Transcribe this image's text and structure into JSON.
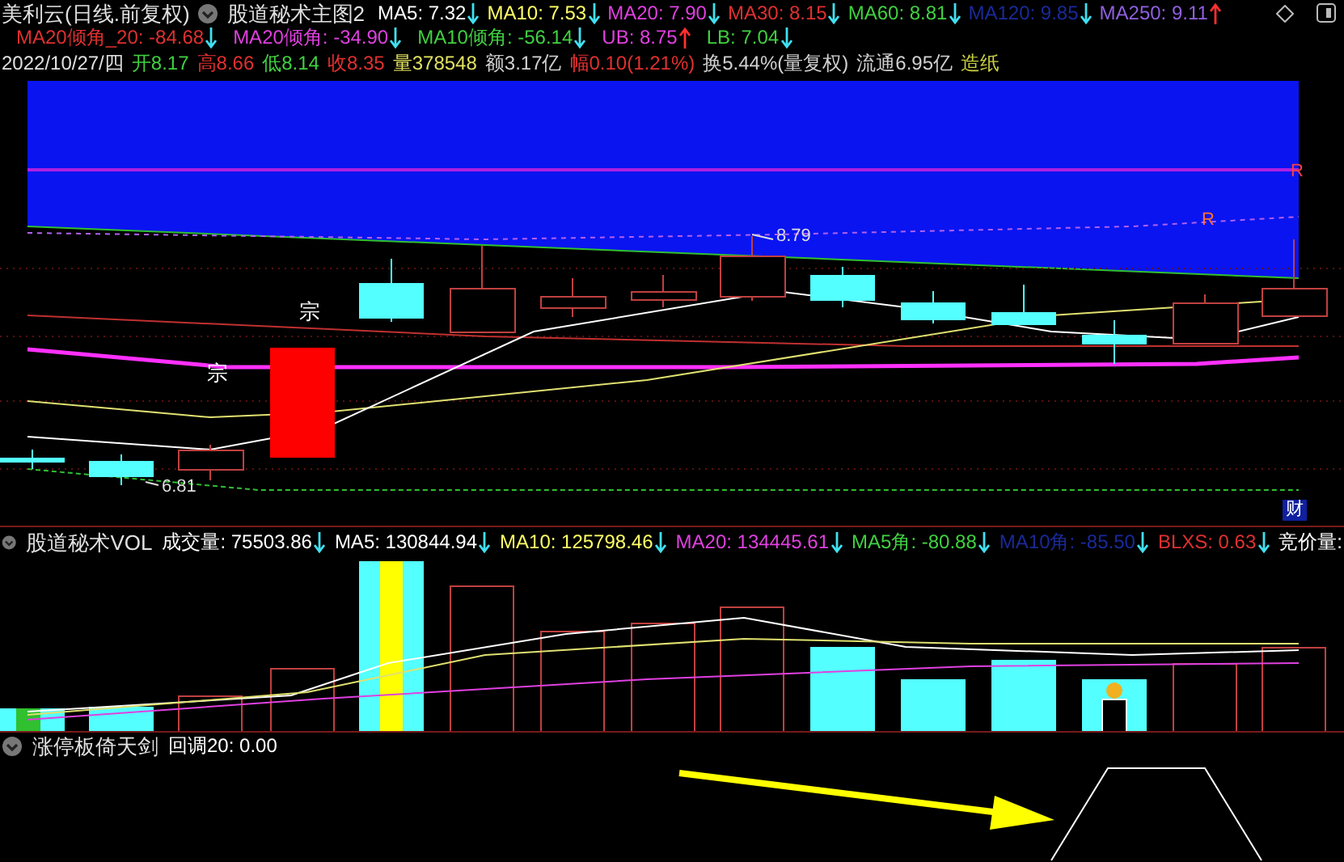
{
  "header": {
    "title": "美利云(日线.前复权)",
    "indicator": "股道秘术主图2",
    "values": [
      {
        "text": "MA5: 7.32",
        "color": "#ffffff",
        "rising": false
      },
      {
        "text": "MA10: 7.53",
        "color": "#ffff66",
        "rising": false
      },
      {
        "text": "MA20: 7.90",
        "color": "#e040e0",
        "rising": false
      },
      {
        "text": "MA30: 8.15",
        "color": "#e03030",
        "rising": false
      },
      {
        "text": "MA60: 8.81",
        "color": "#40d040",
        "rising": false
      },
      {
        "text": "MA120: 9.85",
        "color": "#1a2a9a",
        "rising": false
      },
      {
        "text": "MA250: 9.11",
        "color": "#9060e0",
        "rising": true
      }
    ],
    "values_2": [
      {
        "text": "MA20倾角_20: -84.68",
        "color": "#e03030",
        "rising": false
      },
      {
        "text": "MA20倾角: -34.90",
        "color": "#e040e0",
        "rising": false
      },
      {
        "text": "MA10倾角: -56.14",
        "color": "#40d040",
        "rising": false
      },
      {
        "text": "UB: 8.75",
        "color": "#e040e0",
        "rising": true
      },
      {
        "text": "LB: 7.04",
        "color": "#40d040",
        "rising": false
      }
    ]
  },
  "quote": {
    "date": "2022/10/27/四",
    "items": [
      {
        "text": "开8.17",
        "color": "#40d040"
      },
      {
        "text": "高8.66",
        "color": "#e03030"
      },
      {
        "text": "低8.14",
        "color": "#40d040"
      },
      {
        "text": "收8.35",
        "color": "#e03030"
      },
      {
        "text": "量378548",
        "color": "#e0e060"
      },
      {
        "text": "额3.17亿",
        "color": "#d0d0d0"
      },
      {
        "text": "幅0.10(1.21%)",
        "color": "#e03030"
      },
      {
        "text": "换5.44%(量复权)",
        "color": "#d0d0d0"
      },
      {
        "text": "流通6.95亿",
        "color": "#d0d0d0"
      },
      {
        "text": "造纸",
        "color": "#c8d040"
      }
    ]
  },
  "main_chart": {
    "labels": [
      {
        "text": "宗",
        "kind": "mark"
      },
      {
        "text": "宗",
        "kind": "mark"
      },
      {
        "text": "8.79",
        "kind": "high"
      },
      {
        "text": "6.81",
        "kind": "low"
      },
      {
        "text": "R",
        "kind": "r_right"
      },
      {
        "text": "R",
        "kind": "r_mid"
      },
      {
        "text": "财",
        "kind": "badge"
      }
    ]
  },
  "volume": {
    "indicator": "股道秘术VOL",
    "values": [
      {
        "text": "成交量: 75503.86",
        "color": "#ffffff",
        "rising": false
      },
      {
        "text": "MA5: 130844.94",
        "color": "#ffffff",
        "rising": false
      },
      {
        "text": "MA10: 125798.46",
        "color": "#ffff66",
        "rising": false
      },
      {
        "text": "MA20: 134445.61",
        "color": "#e040e0",
        "rising": false
      },
      {
        "text": "MA5角: -80.88",
        "color": "#40d040",
        "rising": false
      },
      {
        "text": "MA10角: -85.50",
        "color": "#1a2a9a",
        "rising": false
      },
      {
        "text": "BLXS: 0.63",
        "color": "#e03030",
        "rising": false
      },
      {
        "text": "竞价量:",
        "color": "#ffffff"
      }
    ]
  },
  "bottom": {
    "indicator": "涨停板倚天剑",
    "values": [
      {
        "text": "回调20: 0.00",
        "color": "#ffffff"
      }
    ]
  }
}
